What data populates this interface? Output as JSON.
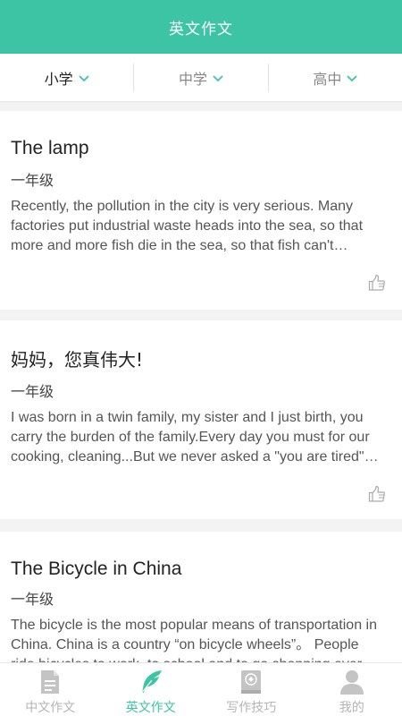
{
  "header": {
    "title": "英文作文"
  },
  "filters": [
    {
      "label": "小学",
      "active": true
    },
    {
      "label": "中学",
      "active": false
    },
    {
      "label": "高中",
      "active": false
    }
  ],
  "cards": [
    {
      "title": "The lamp",
      "grade": "一年级",
      "excerpt": "Recently, the pollution in the city is very serious. Many factories put industrial waste heads into the sea, so that more and more fish die in the sea, so that fish can't survive and people's health is in danger."
    },
    {
      "title": "妈妈，您真伟大!",
      "grade": "一年级",
      "excerpt": "I was born in a twin family, my sister and I just birth, you carry the burden of the family.Every day you must for our cooking, cleaning...But we never asked a \"you are tired\" to you."
    },
    {
      "title": "The Bicycle in China",
      "grade": "一年级",
      "excerpt": "The bicycle is the most popular means of transportation in China. China is a country “on bicycle wheels”。 People ride bicycles to work, to school and to go shopping every day."
    }
  ],
  "tabs": [
    {
      "label": "中文作文",
      "icon": "document-icon",
      "active": false
    },
    {
      "label": "英文作文",
      "icon": "feather-icon",
      "active": true
    },
    {
      "label": "写作技巧",
      "icon": "book-icon",
      "active": false
    },
    {
      "label": "我的",
      "icon": "person-icon",
      "active": false
    }
  ],
  "colors": {
    "accent": "#3cc4a4",
    "inactive": "#b5b5b5"
  }
}
